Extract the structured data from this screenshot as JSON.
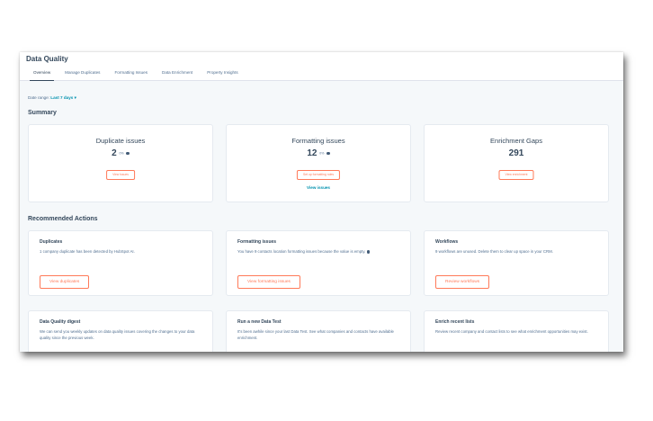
{
  "header": {
    "title": "Data Quality",
    "tabs": [
      "Overview",
      "Manage Duplicates",
      "Formatting Issues",
      "Data Enrichment",
      "Property Insights"
    ]
  },
  "date_range": {
    "label": "Date range:",
    "value": "Last 7 days"
  },
  "summary": {
    "title": "Summary",
    "cards": [
      {
        "title": "Duplicate issues",
        "value": "2",
        "pct": "0%",
        "button": "View issues"
      },
      {
        "title": "Formatting issues",
        "value": "12",
        "pct": "0%",
        "button": "Set up formatting rules",
        "link": "View issues"
      },
      {
        "title": "Enrichment Gaps",
        "value": "291",
        "button": "View enrichment"
      }
    ]
  },
  "recommended": {
    "title": "Recommended Actions",
    "cards": [
      {
        "title": "Duplicates",
        "desc": "1 company duplicate has been detected by HubSpot AI.",
        "button": "View duplicates"
      },
      {
        "title": "Formatting issues",
        "desc": "You have 9 contacts location formatting issues because the value is empty.",
        "button": "View formatting issues"
      },
      {
        "title": "Workflows",
        "desc": "9 workflows are unused. Delete them to clear up space in your CRM.",
        "button": "Review workflows"
      },
      {
        "title": "Data Quality digest",
        "desc": "We can send you weekly updates on data quality issues covering the changes to your data quality since the previous week."
      },
      {
        "title": "Run a new Data Test",
        "desc": "It's been awhile since your last Data Test. See what companies and contacts have available enrichment."
      },
      {
        "title": "Enrich recent lists",
        "desc": "Review recent company and contact lists to see what enrichment opportunities may exist."
      }
    ]
  },
  "colors": {
    "accent": "#ff7a59",
    "link": "#0091ae",
    "text": "#33475b",
    "background": "#f5f8fa"
  },
  "icons": {
    "info": "info-icon",
    "caret": "caret-down-icon"
  }
}
